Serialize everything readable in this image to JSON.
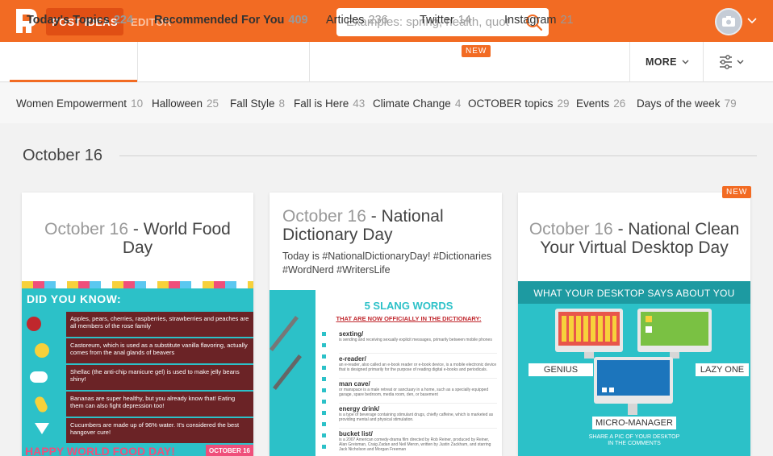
{
  "header": {
    "nav_active": "POST IDEAS",
    "nav_editor": "EDITOR",
    "search_placeholder": "Examples: spring, health, quot"
  },
  "tabs": [
    {
      "label": "Today's Topics",
      "count": "224"
    },
    {
      "label": "Recommended For You",
      "count": "409"
    },
    {
      "label": "Articles",
      "count": "236"
    },
    {
      "label": "Twitter",
      "count": "14",
      "badge": "NEW"
    },
    {
      "label": "Instagram",
      "count": "21"
    }
  ],
  "more_label": "MORE",
  "topics": [
    {
      "label": "Women Empowerment",
      "count": "10"
    },
    {
      "label": "Halloween",
      "count": "25"
    },
    {
      "label": "Fall Style",
      "count": "8"
    },
    {
      "label": "Fall is Here",
      "count": "43"
    },
    {
      "label": "Climate Change",
      "count": "4"
    },
    {
      "label": "OCTOBER topics",
      "count": "29"
    },
    {
      "label": "Events",
      "count": "26"
    },
    {
      "label": "Days of the week",
      "count": "79"
    }
  ],
  "section_date": "October 16",
  "cards": [
    {
      "date": "October 16",
      "title": " - World Food Day",
      "image": {
        "heading": "DID YOU KNOW:",
        "facts": [
          "Apples, pears, cherries, raspberries, strawberries and peaches are all members of the rose family",
          "Castoreum, which is used as a substitute vanilla flavoring, actually comes from the anal glands of beavers",
          "Shellac (the anti-chip manicure gel) is used to make jelly beans shiny!",
          "Bananas are super healthy, but you already know that! Eating them can also fight depression too!",
          "Cucumbers are made up of 96% water. It's considered the best hangover cure!"
        ],
        "footer": "HAPPY WORLD FOOD DAY!",
        "footer_tag": "OCTOBER 16"
      }
    },
    {
      "date": "October 16",
      "title": " - National Dictionary Day",
      "desc": "Today is #NationalDictionaryDay! #Dictionaries #WordNerd #WritersLife",
      "image": {
        "heading": "5 SLANG WORDS",
        "subheading": "THAT ARE NOW OFFICIALLY IN THE DICTIONARY:",
        "words": [
          {
            "word": "sexting/",
            "def": "is sending and receiving sexually explicit messages, primarily between mobile phones"
          },
          {
            "word": "e-reader/",
            "def": "an e-reader, also called an e-book reader or e-book device, is a mobile electronic device that is designed primarily for the purpose of reading digital e-books and periodicals."
          },
          {
            "word": "man cave/",
            "def": "or manspace is a male retreat or sanctuary in a home, such as a specially equipped garage, spare bedroom, media room, den, or basement"
          },
          {
            "word": "energy drink/",
            "def": "is a type of beverage containing stimulant drugs, chiefly caffeine, which is marketed as providing mental and physical stimulation."
          },
          {
            "word": "bucket list/",
            "def": "is a 2007 American comedy-drama film directed by Rob Reiner, produced by Reiner, Alan Greisman, Craig Zadan and Neil Meron, written by Justin Zackham, and starring Jack Nicholson and Morgan Freeman"
          }
        ]
      }
    },
    {
      "date": "October 16",
      "title": " - National Clean Your Virtual Desktop Day",
      "badge": "NEW",
      "image": {
        "heading": "WHAT YOUR DESKTOP SAYS ABOUT YOU",
        "labels": [
          "GENIUS",
          "LAZY ONE",
          "MICRO-MANAGER"
        ],
        "footer": "SHARE A PIC OF YOUR DESKTOP IN THE COMMENTS"
      }
    }
  ],
  "colors": {
    "brand": "#f26b23",
    "brand_dark": "#e04f14",
    "teal": "#2cc1c8",
    "maroon": "#6b2326"
  }
}
